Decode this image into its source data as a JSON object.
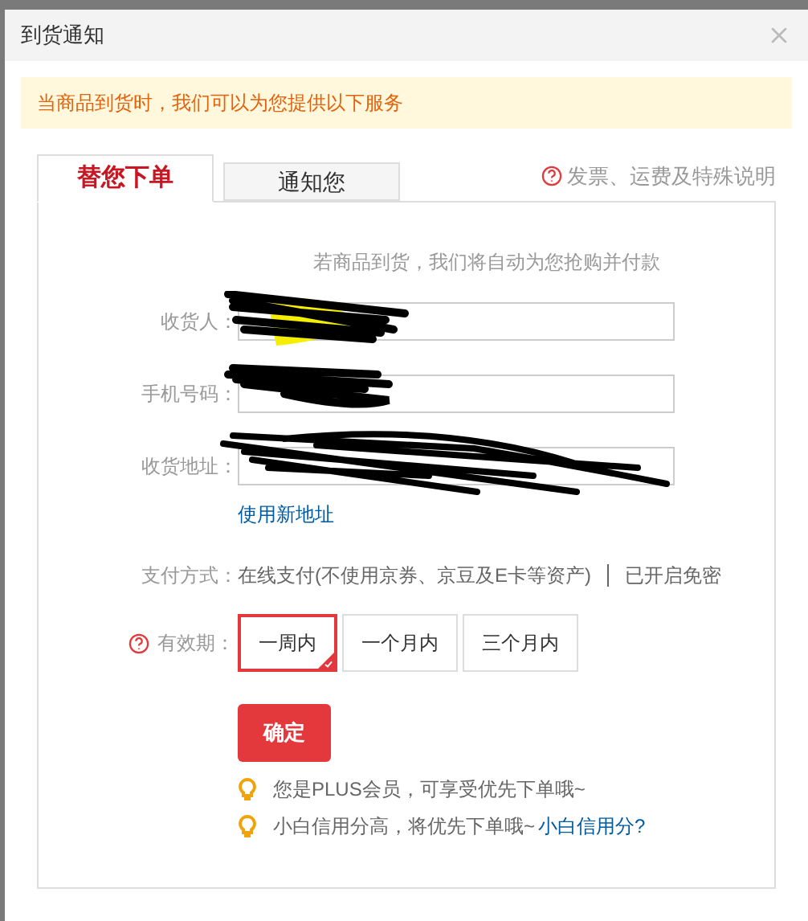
{
  "window": {
    "title": "到货通知"
  },
  "notice": "当商品到货时，我们可以为您提供以下服务",
  "tabs": [
    {
      "label": "替您下单",
      "selected": true
    },
    {
      "label": "通知您",
      "selected": false
    }
  ],
  "help_link": "发票、运费及特殊说明",
  "intro": "若商品到货，我们将自动为您抢购并付款",
  "fields": [
    {
      "label": "收货人："
    },
    {
      "label": "手机号码："
    },
    {
      "label": "收货地址："
    }
  ],
  "new_address_link": "使用新地址",
  "payment": {
    "label": "支付方式：",
    "value": "在线支付(不使用京券、京豆及E卡等资产)",
    "status": "已开启免密"
  },
  "validity": {
    "label": "有效期：",
    "options": [
      {
        "label": "一周内",
        "selected": true
      },
      {
        "label": "一个月内",
        "selected": false
      },
      {
        "label": "三个月内",
        "selected": false
      }
    ]
  },
  "confirm_button": "确定",
  "tips": [
    {
      "text": "您是PLUS会员，可享受优先下单哦~"
    },
    {
      "text": "小白信用分高，将优先下单哦~",
      "link": "小白信用分?"
    }
  ]
}
